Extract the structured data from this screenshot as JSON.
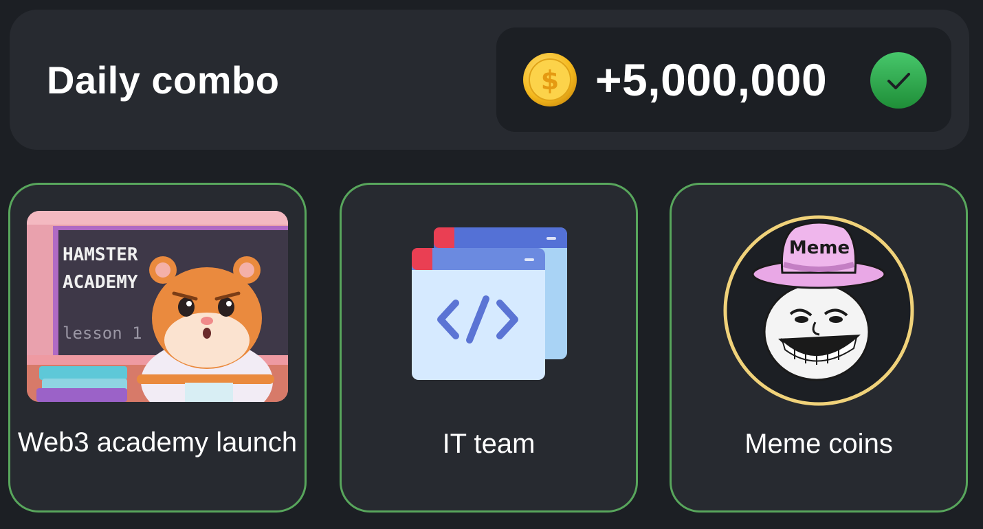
{
  "header": {
    "title": "Daily combo",
    "reward": "+5,000,000",
    "coin_icon": "dollar-coin-icon",
    "status_icon": "checkmark-icon",
    "status_color": "#2fa44a"
  },
  "cards": [
    {
      "label": "Web3 academy launch",
      "image_text": {
        "line1": "HAMSTER",
        "line2": "ACADEMY",
        "line3": "lesson 1"
      },
      "image": "hamster-academy-lesson-icon"
    },
    {
      "label": "IT team",
      "image": "code-window-icon"
    },
    {
      "label": "Meme coins",
      "image_text": {
        "hat": "Meme"
      },
      "image": "troll-face-meme-hat-icon"
    }
  ],
  "colors": {
    "background": "#1c1f24",
    "panel": "#272a30",
    "card_border": "#58a65c",
    "coin": "#f5c233"
  }
}
